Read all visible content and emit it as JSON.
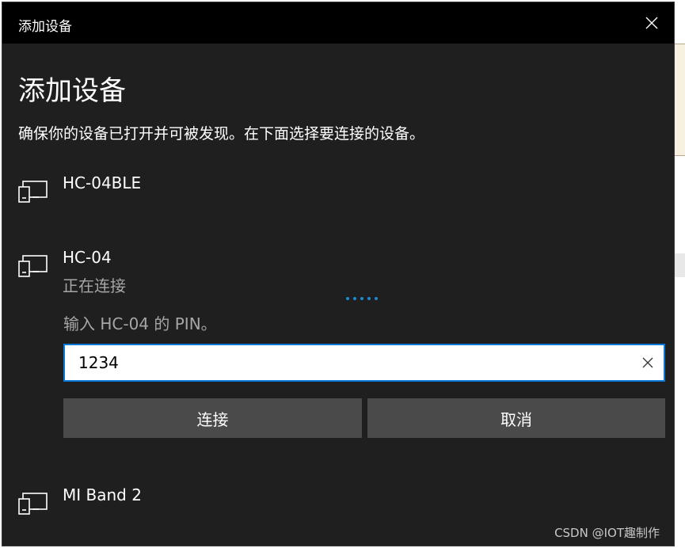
{
  "window": {
    "title": "添加设备"
  },
  "heading": "添加设备",
  "subtitle": "确保你的设备已打开并可被发现。在下面选择要连接的设备。",
  "devices": [
    {
      "name": "HC-04BLE",
      "icon": "device-icon"
    },
    {
      "name": "HC-04",
      "status": "正在连接",
      "icon": "device-icon"
    },
    {
      "name": "MI Band 2",
      "icon": "device-icon"
    }
  ],
  "pairing": {
    "prompt": "输入 HC-04 的 PIN。",
    "pin_value": "1234",
    "connect_label": "连接",
    "cancel_label": "取消",
    "accent_color": "#0a78d7"
  },
  "watermark": "CSDN @IOT趣制作"
}
